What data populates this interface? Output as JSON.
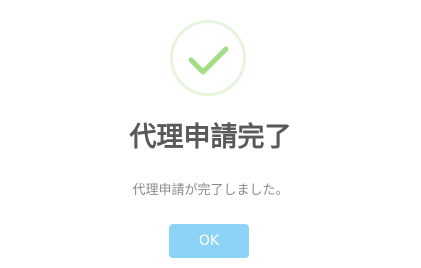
{
  "dialog": {
    "icon": "check-icon",
    "icon_color": "#a5dc86",
    "title": "代理申請完了",
    "message": "代理申請が完了しました。",
    "ok_label": "OK",
    "ok_button_color": "#8dd3f6"
  }
}
